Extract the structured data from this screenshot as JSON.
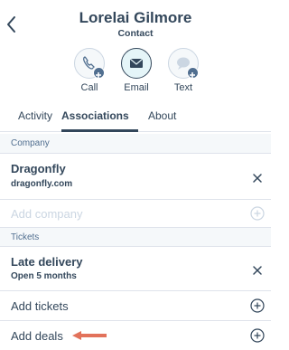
{
  "header": {
    "name": "Lorelai Gilmore",
    "subtitle": "Contact"
  },
  "actions": [
    {
      "label": "Call",
      "icon": "phone-icon"
    },
    {
      "label": "Email",
      "icon": "envelope-icon"
    },
    {
      "label": "Text",
      "icon": "chat-icon"
    }
  ],
  "tabs": [
    {
      "label": "Activity"
    },
    {
      "label": "Associations"
    },
    {
      "label": "About"
    }
  ],
  "active_tab": "Associations",
  "sections": {
    "company": {
      "header": "Company",
      "item": {
        "title": "Dragonfly",
        "subtitle": "dragonfly.com"
      },
      "add_label": "Add company"
    },
    "tickets": {
      "header": "Tickets",
      "item": {
        "title": "Late delivery",
        "subtitle": "Open 5 months"
      },
      "add_label": "Add tickets"
    },
    "deals": {
      "add_label": "Add deals"
    }
  },
  "colors": {
    "text": "#33475b",
    "accent_arrow": "#e2725b",
    "divider": "#dfe3eb",
    "muted": "#cbd6e2"
  }
}
